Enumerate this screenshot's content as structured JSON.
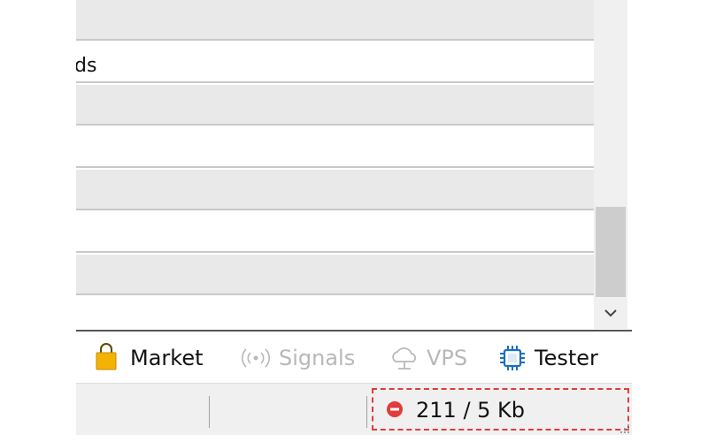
{
  "list": {
    "rows": [
      {
        "text": ""
      },
      {
        "text": "ds"
      },
      {
        "text": ""
      },
      {
        "text": ""
      },
      {
        "text": ""
      },
      {
        "text": ""
      },
      {
        "text": ""
      },
      {
        "text": ""
      }
    ]
  },
  "tabs": {
    "market": {
      "label": "Market",
      "icon": "shopping-bag-icon"
    },
    "signals": {
      "label": "Signals",
      "icon": "broadcast-icon"
    },
    "vps": {
      "label": "VPS",
      "icon": "cloud-icon"
    },
    "tester": {
      "label": "Tester",
      "icon": "chip-icon"
    }
  },
  "statusbar": {
    "traffic_label": "211 / 5 Kb",
    "traffic_icon": "no-entry-icon",
    "status_color": "#e23b3b"
  },
  "colors": {
    "market_icon": "#f5b301",
    "tester_icon": "#1a6fc4",
    "disabled_text": "#b8b8b8"
  }
}
